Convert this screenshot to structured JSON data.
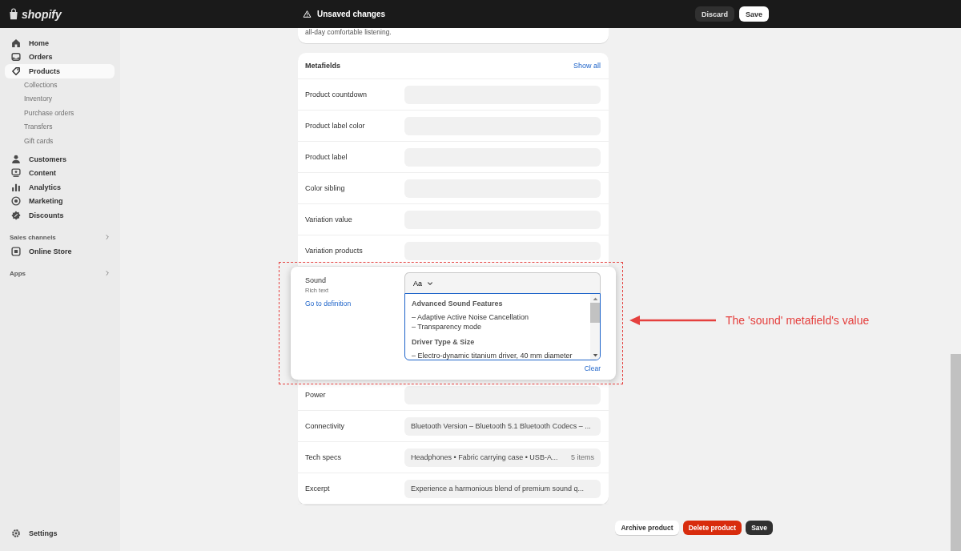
{
  "topbar": {
    "logo": "shopify",
    "status": "Unsaved changes",
    "buttons": [
      {
        "label": "Discard",
        "kind": "secondary"
      },
      {
        "label": "Save",
        "kind": "primary"
      }
    ]
  },
  "sidebar": {
    "items": [
      {
        "label": "Home",
        "selected": false
      },
      {
        "label": "Orders",
        "selected": false
      },
      {
        "label": "Products",
        "selected": true,
        "children": [
          {
            "label": "Collections"
          },
          {
            "label": "Inventory"
          },
          {
            "label": "Purchase orders"
          },
          {
            "label": "Transfers"
          },
          {
            "label": "Gift cards"
          }
        ]
      },
      {
        "label": "Customers",
        "selected": false
      },
      {
        "label": "Content",
        "selected": false
      },
      {
        "label": "Analytics",
        "selected": false
      },
      {
        "label": "Marketing",
        "selected": false
      },
      {
        "label": "Discounts",
        "selected": false
      }
    ],
    "sections": [
      {
        "label": "Sales channels",
        "items": [
          {
            "label": "Online Store"
          }
        ]
      },
      {
        "label": "Apps"
      }
    ],
    "footer": {
      "label": "Settings"
    }
  },
  "description_tail": "all-day comfortable listening.",
  "metafields": {
    "title": "Metafields",
    "link": "Show all",
    "rows": [
      {
        "kind": "empty",
        "label": "Product countdown"
      },
      {
        "kind": "empty",
        "label": "Product label color"
      },
      {
        "kind": "empty",
        "label": "Product label"
      },
      {
        "kind": "empty",
        "label": "Color sibling"
      },
      {
        "kind": "empty",
        "label": "Variation value"
      },
      {
        "kind": "empty",
        "label": "Variation products"
      },
      {
        "kind": "rich",
        "label": "Sound",
        "type": "Rich text",
        "link": "Go to definition",
        "toolbar": "Aa",
        "clear": "Clear",
        "highlighted": true,
        "content": [
          {
            "kind": "heading",
            "text": "Advanced Sound Features"
          },
          {
            "kind": "line",
            "text": "– Adaptive Active Noise Cancellation"
          },
          {
            "kind": "line",
            "text": "– Transparency mode"
          },
          {
            "kind": "heading",
            "text": "Driver Type & Size"
          },
          {
            "kind": "line",
            "text": "– Electro-dynamic titanium driver, 40 mm diameter"
          }
        ]
      },
      {
        "kind": "empty",
        "label": "Power"
      },
      {
        "kind": "text",
        "label": "Connectivity",
        "value": "Bluetooth Version – Bluetooth 5.1 Bluetooth Codecs – ..."
      },
      {
        "kind": "text",
        "label": "Tech specs",
        "value": "Headphones • Fabric carrying case • USB-A...",
        "count": "5 items"
      },
      {
        "kind": "text",
        "label": "Excerpt",
        "value": "Experience a harmonious blend of premium sound q..."
      }
    ]
  },
  "annotation": {
    "text": "The 'sound' metafield's value"
  },
  "footer_buttons": [
    {
      "label": "Archive product",
      "kind": "secondary"
    },
    {
      "label": "Delete product",
      "kind": "critical"
    },
    {
      "label": "Save",
      "kind": "primary"
    }
  ]
}
